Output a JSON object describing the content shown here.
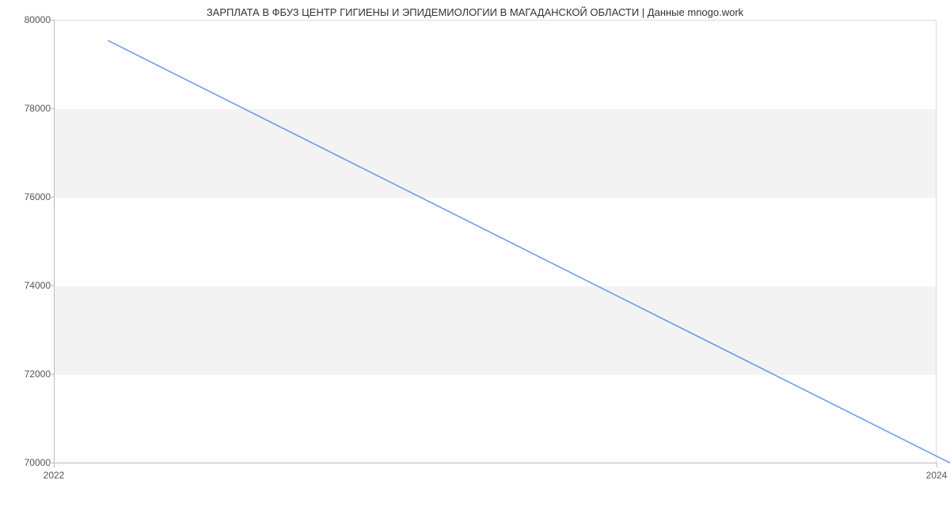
{
  "chart_data": {
    "type": "line",
    "title": "ЗАРПЛАТА В ФБУЗ ЦЕНТР ГИГИЕНЫ И ЭПИДЕМИОЛОГИИ В МАГАДАНСКОЙ ОБЛАСТИ | Данные mnogo.work",
    "x": [
      2022,
      2024
    ],
    "values": [
      80000,
      70000
    ],
    "xlabel": "",
    "ylabel": "",
    "xlim": [
      2022,
      2024
    ],
    "ylim": [
      70000,
      80000
    ],
    "xticks": [
      2022,
      2024
    ],
    "yticks": [
      70000,
      72000,
      74000,
      76000,
      78000,
      80000
    ],
    "line_color": "#6f9be8",
    "bands": [
      {
        "from": 72000,
        "to": 74000
      },
      {
        "from": 76000,
        "to": 78000
      }
    ]
  }
}
